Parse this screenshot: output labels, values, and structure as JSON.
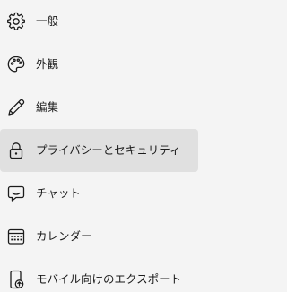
{
  "sidebar": {
    "items": [
      {
        "label": "一般",
        "icon": "gear-icon",
        "selected": false
      },
      {
        "label": "外観",
        "icon": "palette-icon",
        "selected": false
      },
      {
        "label": "編集",
        "icon": "pencil-icon",
        "selected": false
      },
      {
        "label": "プライバシーとセキュリティ",
        "icon": "lock-icon",
        "selected": true
      },
      {
        "label": "チャット",
        "icon": "chat-icon",
        "selected": false
      },
      {
        "label": "カレンダー",
        "icon": "calendar-icon",
        "selected": false
      },
      {
        "label": "モバイル向けのエクスポート",
        "icon": "mobile-export-icon",
        "selected": false
      }
    ],
    "colors": {
      "background": "#f4f4f4",
      "selected_background": "#e0e0e0",
      "text": "#1b1b1b",
      "icon": "#1b1b1b"
    }
  }
}
